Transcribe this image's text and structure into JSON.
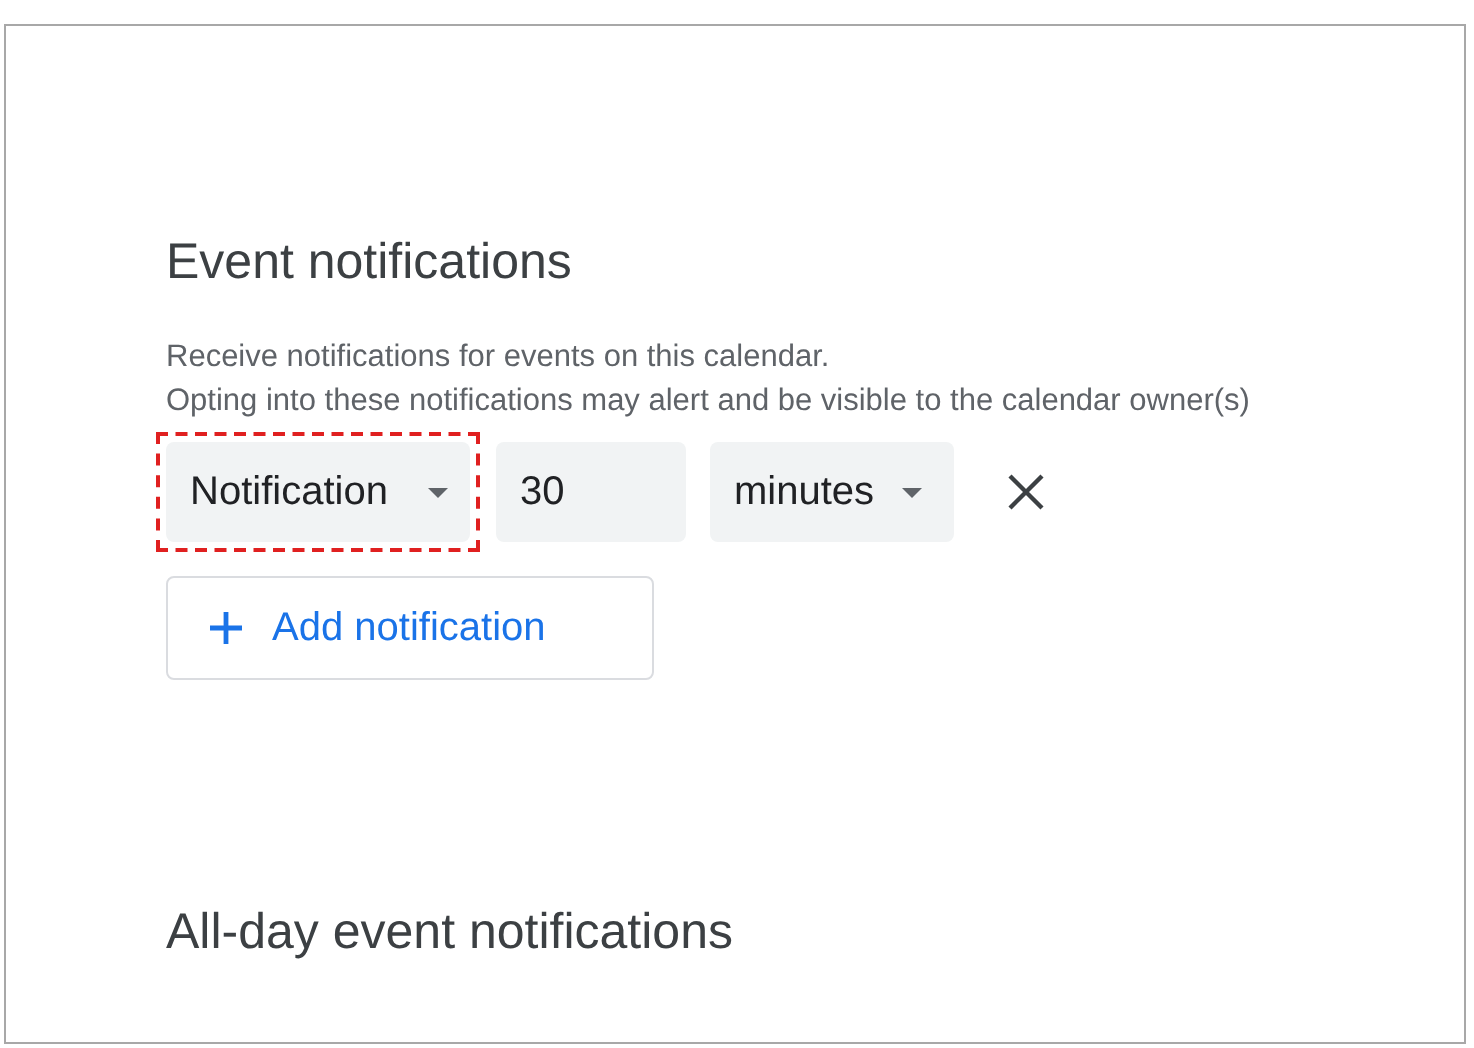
{
  "section": {
    "title": "Event notifications",
    "description": [
      "Receive notifications for events on this calendar.",
      "Opting into these notifications may alert and be visible to the calendar owner(s)"
    ]
  },
  "notifications": [
    {
      "method": "Notification",
      "highlighted": true,
      "amount": "30",
      "unit": "minutes"
    }
  ],
  "add_button": {
    "label": "Add notification"
  },
  "next_section": {
    "title": "All-day event notifications"
  }
}
